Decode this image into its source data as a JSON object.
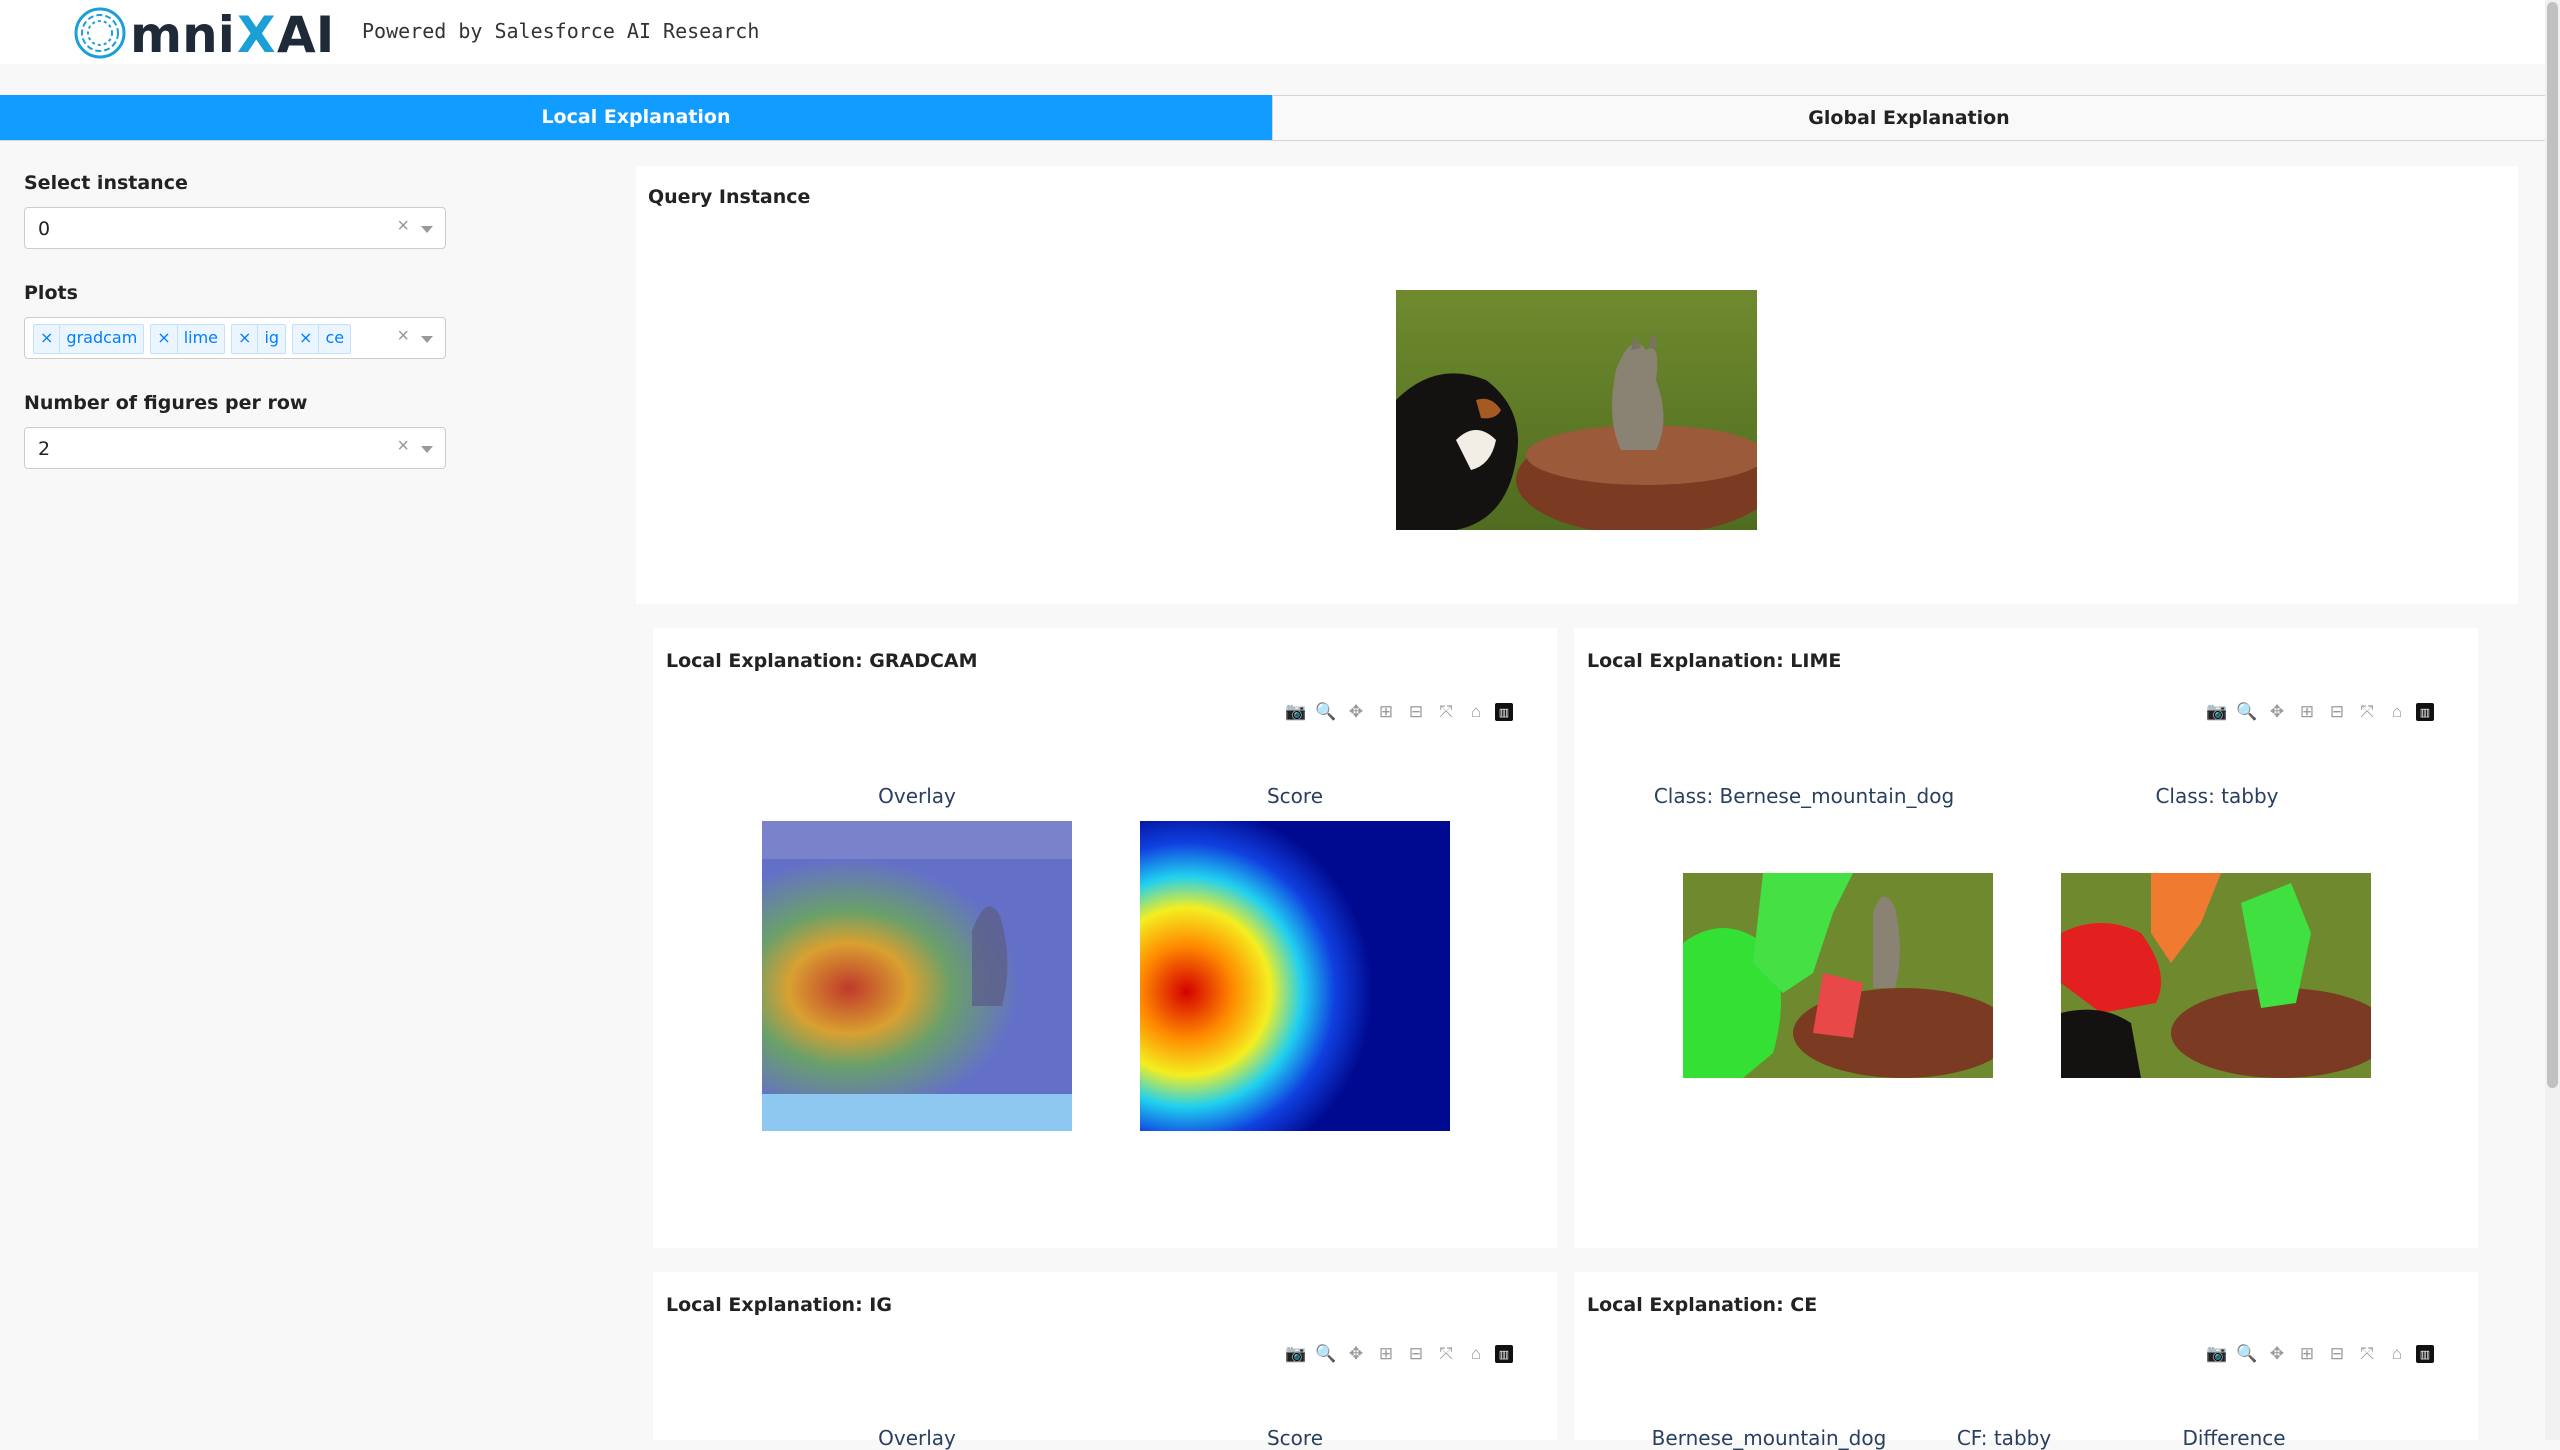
{
  "header": {
    "logo_text": "OmniXAI",
    "powered_by": "Powered by Salesforce AI Research"
  },
  "tabs": {
    "local": "Local Explanation",
    "global": "Global Explanation"
  },
  "sidebar": {
    "instance_label": "Select instance",
    "instance_value": "0",
    "plots_label": "Plots",
    "plots_selected": [
      "gradcam",
      "lime",
      "ig",
      "ce"
    ],
    "figures_label": "Number of figures per row",
    "figures_value": "2"
  },
  "query": {
    "title": "Query Instance",
    "image_icon": "dog-and-cat-photo"
  },
  "panels": {
    "gradcam": {
      "title": "Local Explanation: GRADCAM",
      "sub1": "Overlay",
      "sub2": "Score"
    },
    "lime": {
      "title": "Local Explanation: LIME",
      "sub1": "Class: Bernese_mountain_dog",
      "sub2": "Class: tabby"
    },
    "ig": {
      "title": "Local Explanation: IG",
      "sub1": "Overlay",
      "sub2": "Score"
    },
    "ce": {
      "title": "Local Explanation: CE",
      "sub1": "Bernese_mountain_dog",
      "sub2": "CF: tabby",
      "sub3": "Difference"
    }
  },
  "modebar_icons": [
    "camera-icon",
    "zoom-icon",
    "pan-icon",
    "zoom-in-icon",
    "zoom-out-icon",
    "autoscale-icon",
    "home-icon",
    "plotly-logo-icon"
  ],
  "colors": {
    "accent": "#119dff",
    "chip_text": "#007eff",
    "chip_bg": "#ebf5ff"
  }
}
